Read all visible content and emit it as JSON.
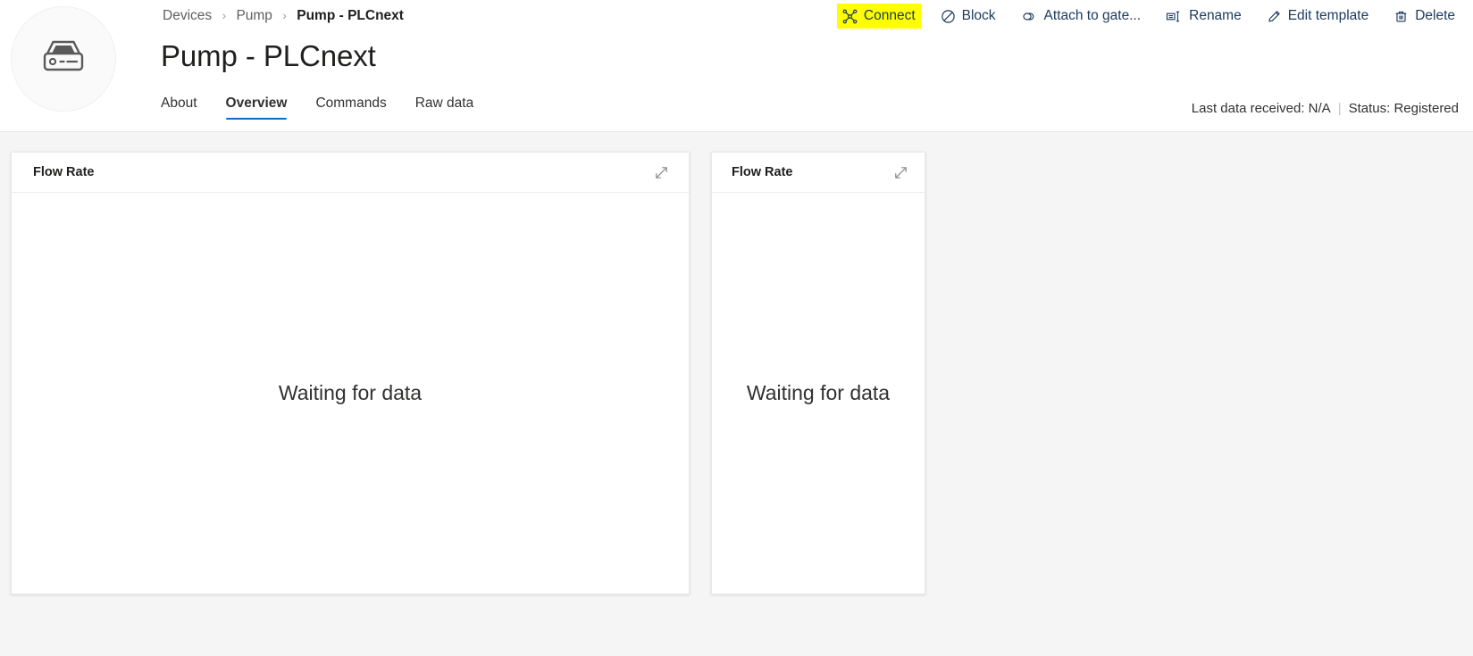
{
  "header": {
    "avatar_icon": "device-icon",
    "breadcrumb": {
      "items": [
        {
          "label": "Devices",
          "current": false
        },
        {
          "label": "Pump",
          "current": false
        },
        {
          "label": "Pump - PLCnext",
          "current": true
        }
      ],
      "separator": "›"
    },
    "title": "Pump - PLCnext",
    "tabs": [
      {
        "label": "About",
        "active": false
      },
      {
        "label": "Overview",
        "active": true
      },
      {
        "label": "Commands",
        "active": false
      },
      {
        "label": "Raw data",
        "active": false
      }
    ],
    "toolbar": [
      {
        "label": "Connect",
        "icon": "connect-hub-icon",
        "highlighted": true
      },
      {
        "label": "Block",
        "icon": "block-icon",
        "highlighted": false
      },
      {
        "label": "Attach to gate...",
        "icon": "link-icon",
        "highlighted": false
      },
      {
        "label": "Rename",
        "icon": "rename-icon",
        "highlighted": false
      },
      {
        "label": "Edit template",
        "icon": "pencil-icon",
        "highlighted": false
      },
      {
        "label": "Delete",
        "icon": "trash-icon",
        "highlighted": false
      }
    ],
    "status": {
      "last_data_received": "Last data received: N/A",
      "divider": "|",
      "device_status": "Status: Registered"
    }
  },
  "main": {
    "cards": [
      {
        "title": "Flow Rate",
        "body_text": "Waiting for data",
        "expand_icon": "expand-diagonal-icon",
        "size": "wide"
      },
      {
        "title": "Flow Rate",
        "body_text": "Waiting for data",
        "expand_icon": "expand-diagonal-icon",
        "size": "narrow"
      }
    ]
  },
  "colors": {
    "accent": "#0f6cbd",
    "toolbar_text": "#1b3a5c",
    "highlight": "#ffff00",
    "page_background": "#f5f5f5",
    "card_background": "#ffffff"
  }
}
